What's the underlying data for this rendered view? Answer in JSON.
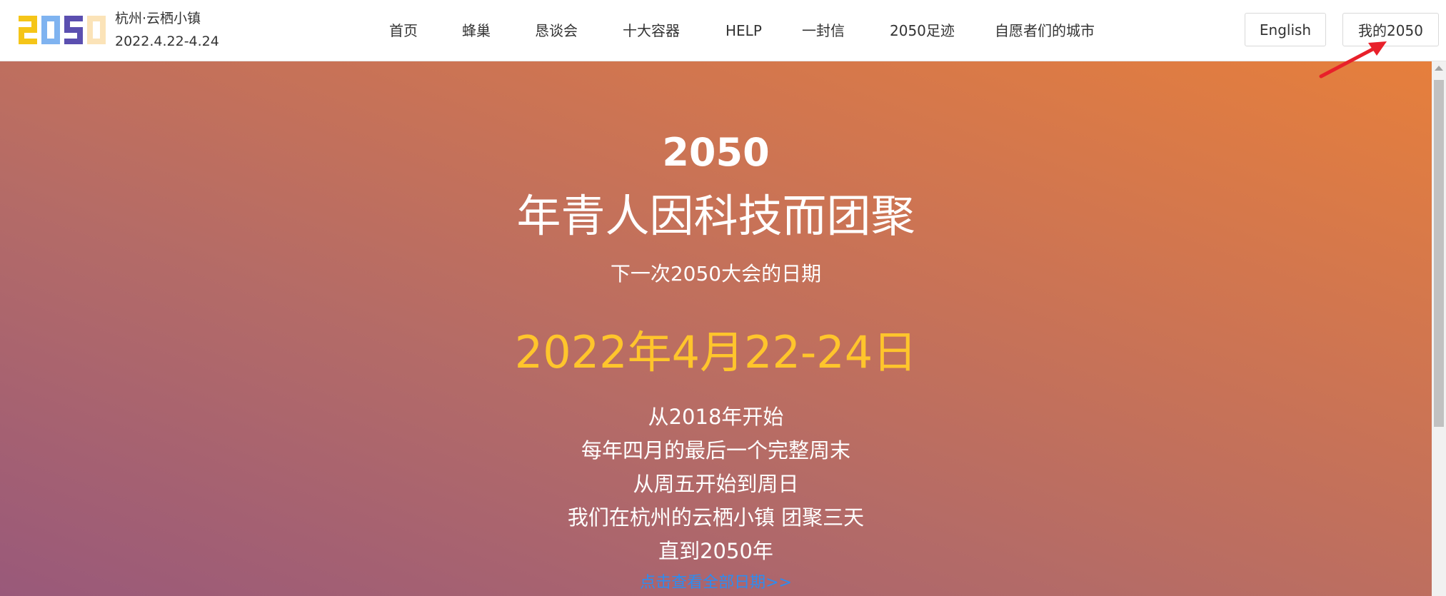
{
  "header": {
    "logo_text": "2050",
    "location": "杭州·云栖小镇",
    "dates": "2022.4.22-4.24",
    "nav": [
      {
        "label": "首页"
      },
      {
        "label": "蜂巢"
      },
      {
        "label": "恳谈会"
      },
      {
        "label": "十大容器"
      },
      {
        "label": "HELP"
      },
      {
        "label": "一封信"
      },
      {
        "label": "2050足迹"
      },
      {
        "label": "自愿者们的城市"
      }
    ],
    "english_label": "English",
    "my2050_label": "我的2050"
  },
  "hero": {
    "year": "2050",
    "slogan": "年青人因科技而团聚",
    "next_label": "下一次2050大会的日期",
    "date": "2022年4月22-24日",
    "lines": [
      "从2018年开始",
      "每年四月的最后一个完整周末",
      "从周五开始到周日",
      "我们在杭州的云栖小镇 团聚三天",
      "直到2050年"
    ],
    "all_dates_link": "点击查看全部日期>>"
  },
  "colors": {
    "date_accent": "#ffc52c",
    "link": "#2d8cf0",
    "logo_yellow": "#f5c518",
    "logo_blue": "#7fb3f0",
    "logo_purple": "#5b4fb0",
    "logo_cream": "#fbe3b8",
    "annotation_arrow": "#e8202a"
  }
}
